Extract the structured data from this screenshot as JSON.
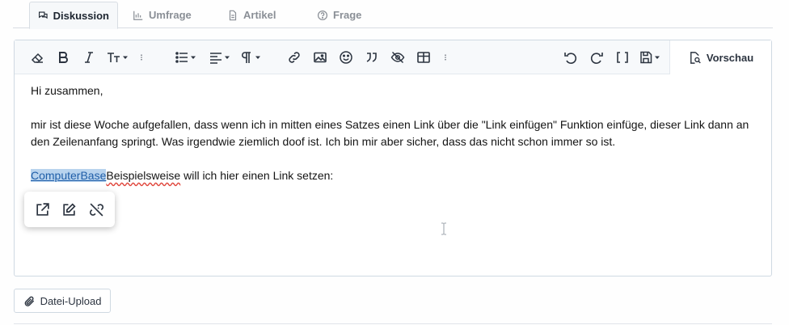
{
  "tabs": [
    {
      "label": "Diskussion",
      "icon": "discussion-icon",
      "active": true
    },
    {
      "label": "Umfrage",
      "icon": "bar-chart-icon",
      "active": false
    },
    {
      "label": "Artikel",
      "icon": "document-icon",
      "active": false
    },
    {
      "label": "Frage",
      "icon": "question-icon",
      "active": false
    }
  ],
  "toolbar": {
    "preview_label": "Vorschau"
  },
  "content": {
    "greeting": "Hi zusammen,",
    "paragraph": "mir ist diese Woche aufgefallen, dass wenn ich in mitten eines Satzes einen Link über die \"Link einfügen\" Funktion einfüge, dieser Link dann an den Zeilenanfang springt. Was irgendwie ziemlich doof ist. Ich bin mir aber sicher, dass das nicht schon immer so ist.",
    "link_text": "ComputerBase",
    "misspelled_word": "Beispielsweise",
    "line_rest": " will ich hier einen Link setzen:"
  },
  "upload": {
    "label": "Datei-Upload"
  },
  "colors": {
    "link": "#1f5ea8",
    "selection": "#b8d3ee",
    "spellcheck": "#e0463c"
  }
}
